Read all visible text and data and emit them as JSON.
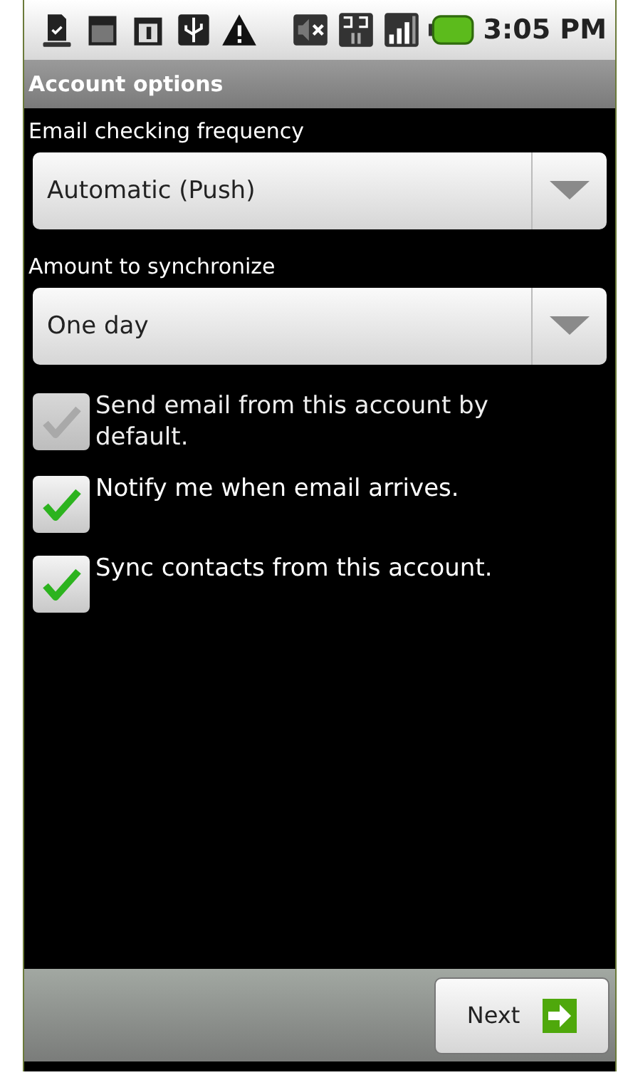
{
  "status_bar": {
    "time": "3:05 PM"
  },
  "title_bar": {
    "title": "Account options"
  },
  "settings": [
    {
      "kind": "spinner",
      "label": "Email checking frequency",
      "value": "Automatic (Push)"
    },
    {
      "kind": "spinner",
      "label": "Amount to synchronize",
      "value": "One day"
    },
    {
      "kind": "checkbox",
      "label": "Send email from this account by default.",
      "checked": true,
      "disabled": true
    },
    {
      "kind": "checkbox",
      "label": "Notify me when email arrives.",
      "checked": true,
      "disabled": false
    },
    {
      "kind": "checkbox",
      "label": "Sync contacts from this account.",
      "checked": true,
      "disabled": false
    }
  ],
  "bottom_bar": {
    "button": "Next"
  }
}
